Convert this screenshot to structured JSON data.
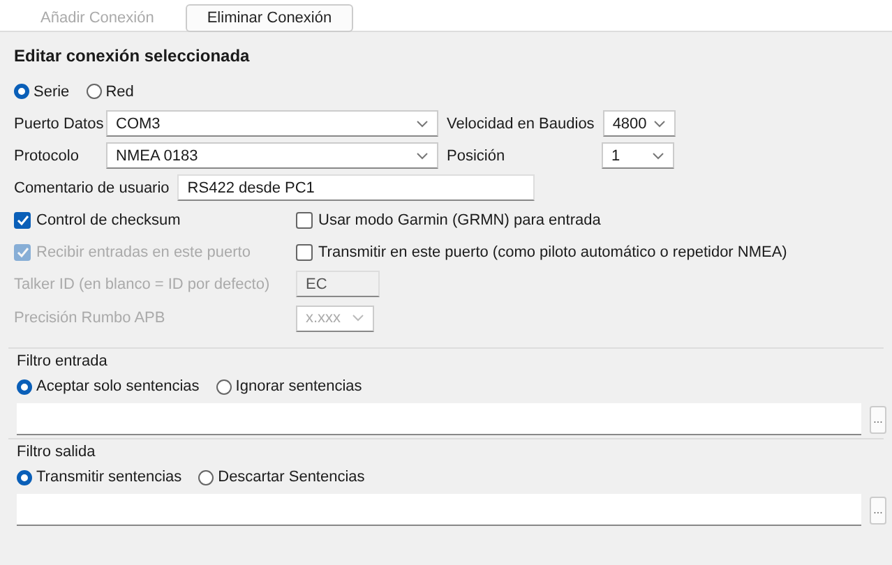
{
  "toolbar": [
    {
      "label": "Añadir Conexión",
      "disabled": true
    },
    {
      "label": "Eliminar Conexión",
      "disabled": false
    }
  ],
  "section_title": "Editar conexión seleccionada",
  "connection_type": [
    {
      "label": "Serie",
      "selected": true
    },
    {
      "label": "Red",
      "selected": false
    }
  ],
  "port": {
    "label": "Puerto Datos",
    "value": "COM3"
  },
  "baud": {
    "label": "Velocidad en Baudios",
    "value": "4800"
  },
  "protocol": {
    "label": "Protocolo",
    "value": "NMEA 0183"
  },
  "position": {
    "label": "Posición",
    "value": "1"
  },
  "comment": {
    "label": "Comentario de usuario",
    "value": "RS422 desde PC1"
  },
  "checks": [
    [
      {
        "label": "Control de checksum",
        "checked": true,
        "disabled": false
      },
      {
        "label": "Usar modo Garmin (GRMN) para entrada",
        "checked": false,
        "disabled": false
      }
    ],
    [
      {
        "label": "Recibir entradas en este puerto",
        "checked": true,
        "disabled": true
      },
      {
        "label": "Transmitir en este puerto (como piloto automático o repetidor NMEA)",
        "checked": false,
        "disabled": false
      }
    ]
  ],
  "talker_id": {
    "label": "Talker ID (en blanco = ID por defecto)",
    "value": "EC",
    "disabled": true
  },
  "apb_precision": {
    "label": "Precisión Rumbo APB",
    "value": "x.xxx",
    "disabled": true
  },
  "filters": [
    {
      "title": "Filtro entrada",
      "options": [
        {
          "label": "Aceptar solo sentencias",
          "selected": true
        },
        {
          "label": "Ignorar sentencias",
          "selected": false
        }
      ],
      "browse": "..."
    },
    {
      "title": "Filtro salida",
      "options": [
        {
          "label": "Transmitir sentencias",
          "selected": true
        },
        {
          "label": "Descartar Sentencias",
          "selected": false
        }
      ],
      "browse": "..."
    }
  ]
}
